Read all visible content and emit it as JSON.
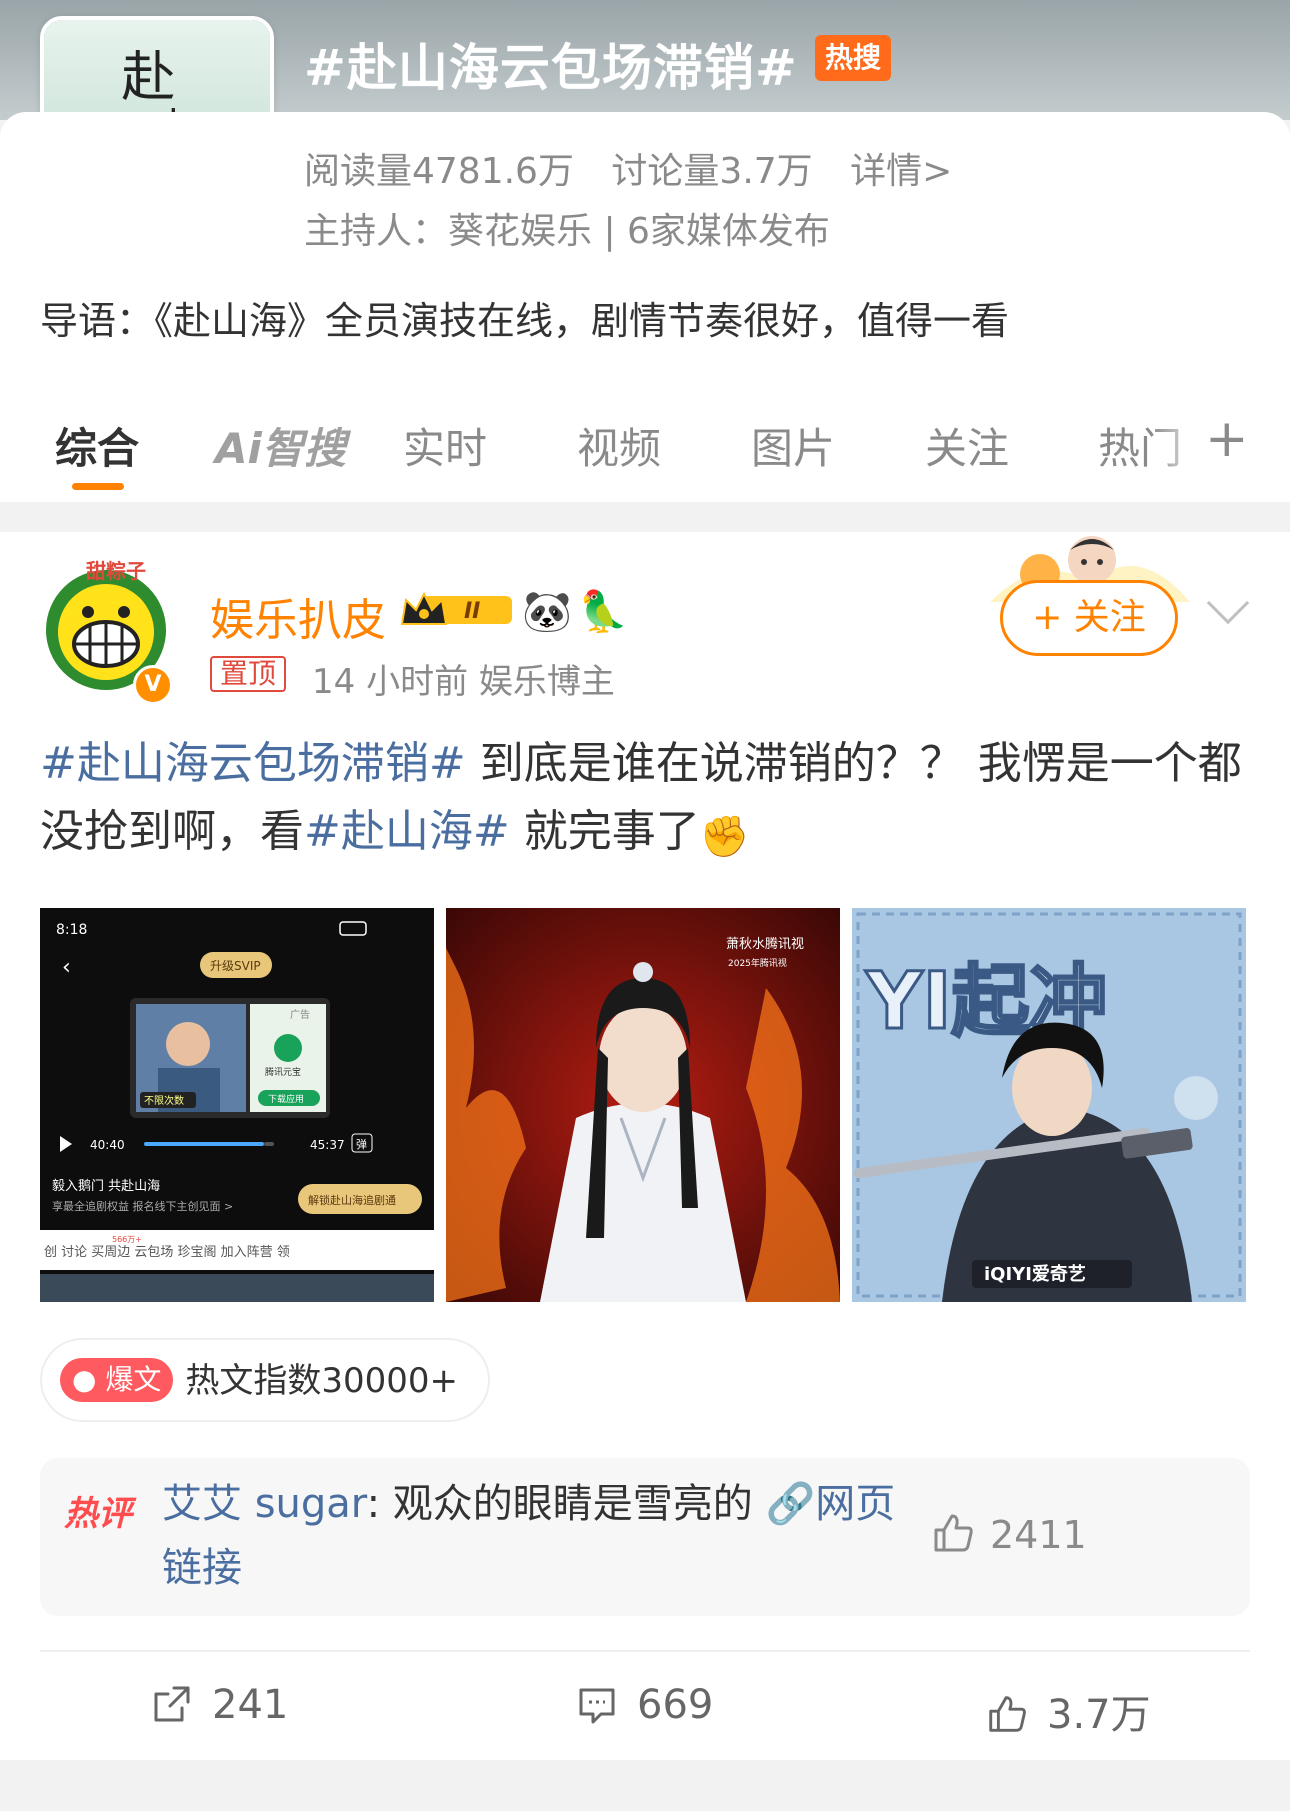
{
  "topic": {
    "title": "#赴山海云包场滞销#",
    "hot_badge": "热搜",
    "reads": "阅读量4781.6万",
    "discussions": "讨论量3.7万",
    "details": "详情>",
    "host": "主持人：葵花娱乐 | 6家媒体发布",
    "intro": "导语：《赴山海》全员演技在线，剧情节奏很好，值得一看"
  },
  "tabs": [
    {
      "label": "综合",
      "active": true
    },
    {
      "label": "Ai智搜"
    },
    {
      "label": "实时"
    },
    {
      "label": "视频"
    },
    {
      "label": "图片"
    },
    {
      "label": "关注"
    },
    {
      "label": "热门"
    }
  ],
  "tab_more": "+",
  "post": {
    "username": "娱乐扒皮",
    "level": "II",
    "pin": "置顶",
    "meta": "14 小时前  娱乐博主",
    "follow": "+ 关注",
    "text_tag1": "#赴山海云包场滞销#",
    "text_part1": " 到底是谁在说滞销的？？ 我愣是一个都没抢到啊，看",
    "text_tag2": "#赴山海#",
    "text_part2": " 就完事了",
    "hot_index_badge": "爆文",
    "hot_index": "热文指数30000+",
    "hot_comment": {
      "tag": "热评",
      "user": "艾艾 sugar",
      "text": ": 观众的眼睛是雪亮的 ",
      "link": "网页链接",
      "likes": "2411"
    },
    "actions": {
      "reposts": "241",
      "comments": "669",
      "likes": "3.7万"
    }
  },
  "images": {
    "img1": {
      "time": "8:18",
      "svip": "升级SVIP",
      "ad": "广告",
      "not_limited": "不限次数",
      "download": "下载应用",
      "tencent": "腾讯元宝",
      "cur": "40:40",
      "total": "45:37",
      "danmaku": "弹",
      "caption1": "毅入鹅门 共赴山海",
      "caption2": "享最全追剧权益 报名线下主创见面 >",
      "unlock": "解锁赴山海追剧通",
      "tabs_row": "创  讨论    买周边  云包场  珍宝阁  加入阵营  领",
      "badge566": "566万+"
    },
    "img2": {
      "corner_text": "萧秋水腾讯视",
      "year": "2025年腾讯视"
    },
    "img3": {
      "title": "YI起冲",
      "brand": "iQIYI爱奇艺"
    }
  },
  "colors": {
    "accent": "#ff8200",
    "topic_link": "#4b6ea0",
    "hot_badge": "#ff6b1a",
    "pin_red": "#e04a3c"
  }
}
